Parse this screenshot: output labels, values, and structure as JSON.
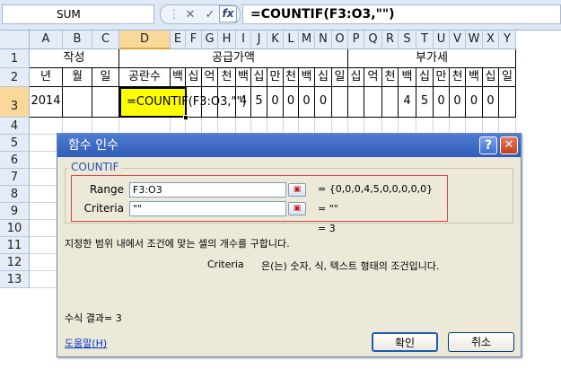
{
  "formula_bar": {
    "name_box": "SUM",
    "cancel": "✕",
    "enter": "✓",
    "fx": "fx",
    "formula": "=COUNTIF(F3:O3,\"\")"
  },
  "columns": [
    "A",
    "B",
    "C",
    "D",
    "E",
    "F",
    "G",
    "H",
    "I",
    "J",
    "K",
    "L",
    "M",
    "N",
    "O",
    "P",
    "Q",
    "R",
    "S",
    "T",
    "U",
    "V",
    "W",
    "X",
    "Y"
  ],
  "rows": [
    "1",
    "2",
    "3",
    "4",
    "5",
    "6",
    "7",
    "8",
    "9",
    "10",
    "11",
    "12",
    "13"
  ],
  "sheet": {
    "r1": {
      "a": "작성",
      "d": "공급가액",
      "p": "부가세"
    },
    "r2": [
      "년",
      "월",
      "일",
      "공란수",
      "백",
      "십",
      "억",
      "천",
      "백",
      "십",
      "만",
      "천",
      "백",
      "십",
      "일",
      "십",
      "억",
      "천",
      "백",
      "십",
      "만",
      "천",
      "백",
      "십",
      "일"
    ],
    "r3": {
      "a": "2014",
      "d": "=COUNTIF(F3:O3,\"\")",
      "cells": [
        "",
        "",
        "",
        "4",
        "5",
        "0",
        "0",
        "0",
        "0",
        "",
        "",
        "",
        "",
        "4",
        "5",
        "0",
        "0",
        "0",
        "0",
        ""
      ]
    }
  },
  "dialog": {
    "title": "함수 인수",
    "help": "?",
    "close": "✕",
    "function_name": "COUNTIF",
    "range_label": "Range",
    "range_value": "F3:O3",
    "range_result": "= {0,0,0,4,5,0,0,0,0,0}",
    "criteria_label": "Criteria",
    "criteria_value": "\"\"",
    "criteria_result": "= \"\"",
    "result_eq": "= 3",
    "description": "지정한 범위 내에서 조건에 맞는 셀의 개수를 구합니다.",
    "arg_desc_name": "Criteria",
    "arg_desc": "은(는) 숫자, 식, 텍스트 형태의 조건입니다.",
    "formula_result": "수식 결과=  3",
    "help_link": "도움말(H)",
    "ok": "확인",
    "cancel": "취소"
  }
}
